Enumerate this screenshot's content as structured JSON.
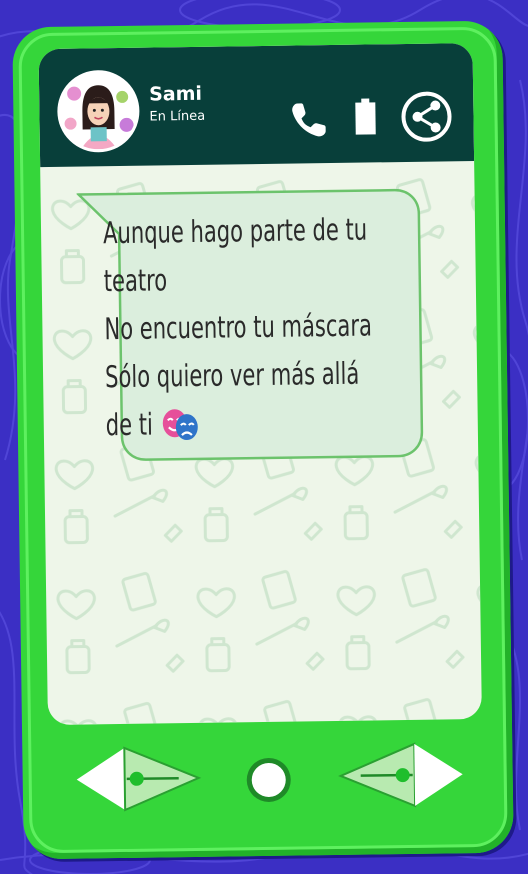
{
  "contact": {
    "name": "Sami",
    "status": "En Línea"
  },
  "message": {
    "lines": [
      "Aunque hago parte de tu",
      "teatro",
      "No encuentro tu máscara",
      "Sólo quiero ver más allá",
      "de ti"
    ],
    "emoji_icon": "theater-masks-icon"
  },
  "icons": {
    "call": "phone-icon",
    "battery": "battery-icon",
    "share": "share-icon",
    "back": "left-arrow-icon",
    "home": "home-circle-icon",
    "forward": "right-arrow-icon"
  },
  "colors": {
    "background": "#3b2fc4",
    "phone_body": "#35d63a",
    "header": "#083f3a",
    "screen": "#eef6e9",
    "bubble": "#dbeedd",
    "bubble_border": "#6cc36c"
  }
}
